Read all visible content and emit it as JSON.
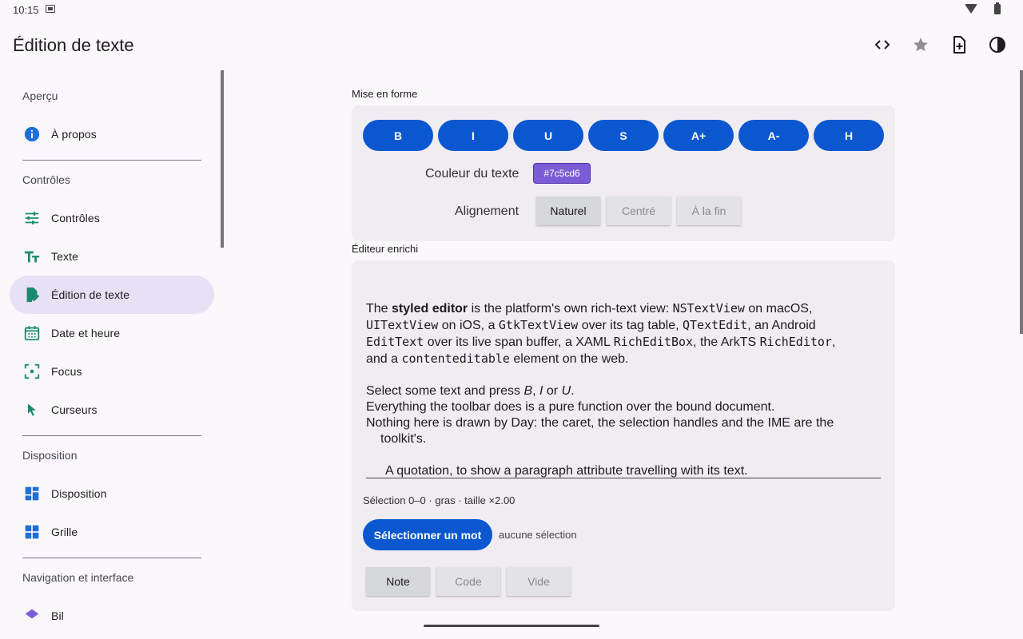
{
  "status": {
    "time": "10:15"
  },
  "appbar": {
    "title": "Édition de texte"
  },
  "sidebar": {
    "sections": {
      "apercu": "Aperçu",
      "controles": "Contrôles",
      "disposition": "Disposition",
      "navigation": "Navigation et interface"
    },
    "items": {
      "a_propos": "À propos",
      "controles": "Contrôles",
      "texte": "Texte",
      "edition": "Édition de texte",
      "date": "Date et heure",
      "focus": "Focus",
      "curseurs": "Curseurs",
      "disposition": "Disposition",
      "grille": "Grille",
      "partial": "Bil"
    }
  },
  "format": {
    "section_label": "Mise en forme",
    "buttons": [
      "B",
      "I",
      "U",
      "S",
      "A+",
      "A-",
      "H"
    ],
    "color_label": "Couleur du texte",
    "color_value": "#7c5cd6",
    "align_label": "Alignement",
    "align_options": [
      "Naturel",
      "Centré",
      "À la fin"
    ],
    "align_selected": "Naturel"
  },
  "editor": {
    "section_label": "Éditeur enrichi",
    "p1": {
      "a": "The ",
      "b_bold": "styled editor",
      "c": " is the platform's own rich-text view: ",
      "d_mono": "NSTextView",
      "e": " on macOS,",
      "f_mono": "UITextView",
      "g": " on iOS, a ",
      "h_mono": "GtkTextView",
      "i": " over its tag table, ",
      "j_mono": "QTextEdit",
      "k": ", an Android",
      "l_mono": "EditText",
      "m": " over its live span buffer, a XAML ",
      "n_mono": "RichEditBox",
      "o": ", the ArkTS ",
      "p_mono": "RichEditor",
      "q": ",",
      "r": "and a ",
      "s_mono": "contenteditable",
      "t": " element on the web."
    },
    "p2": {
      "a": "Select some text and press ",
      "b_it": "B",
      "c": ", ",
      "d_it": "I",
      "e": " or ",
      "f_it": "U",
      "g": "."
    },
    "p3": "Everything the toolbar does is a pure function over the bound document.",
    "p4a": "Nothing here is drawn by Day: the caret, the selection handles and the IME are the",
    "p4b": "toolkit's.",
    "p5": "A quotation, to show a paragraph attribute travelling with its text.",
    "selection_info": "Sélection 0–0 · gras · taille ×2.00",
    "select_word_button": "Sélectionner un mot",
    "no_selection": "aucune sélection",
    "block_options": [
      "Note",
      "Code",
      "Vide"
    ],
    "block_selected": "Note"
  },
  "colors": {
    "accent": "#0b57d0",
    "nav_active": "#e8e0f5",
    "icon_teal": "#1a8a6e",
    "icon_blue": "#1f6fd8"
  }
}
